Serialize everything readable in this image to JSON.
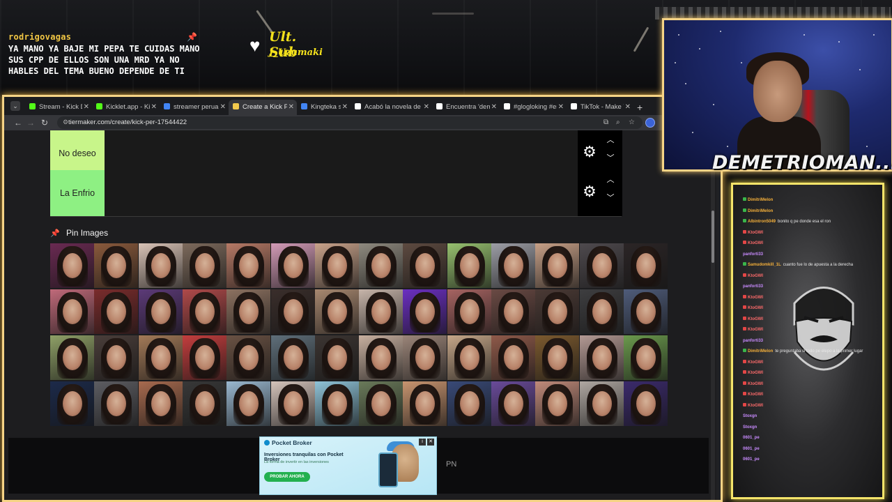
{
  "overlay": {
    "chat_username": "rodrigovagas",
    "chat_message_lines": [
      "YA MANO YA BAJE MI PEPA TE CUIDAS MANO",
      "SUS CPP DE ELLOS SON UNA MRD YA NO",
      "HABLES DEL TEMA BUENO DEPENDE DE TI"
    ],
    "sub_title": "Ult. Sub",
    "sub_name": "J_Uzumaki",
    "streamer_name": "DEMETRIOMAN..."
  },
  "browser": {
    "tabs": [
      {
        "label": "Stream - Kick Dashbo",
        "favicon_color": "#53fc18",
        "active": false
      },
      {
        "label": "Kicklet.app - Kick",
        "favicon_color": "#53fc18",
        "active": false
      },
      {
        "label": "streamer peruano gu",
        "favicon_color": "#4285f4",
        "active": false
      },
      {
        "label": "Create a Kick Perú Ti",
        "favicon_color": "#f2c94c",
        "active": true
      },
      {
        "label": "Kingteka streamer pe",
        "favicon_color": "#4285f4",
        "active": false
      },
      {
        "label": "Acabó la novela de D",
        "favicon_color": "#ffffff",
        "active": false
      },
      {
        "label": "Encuentra 'demetrio",
        "favicon_color": "#ffffff",
        "active": false
      },
      {
        "label": "#glogloking #emeta",
        "favicon_color": "#ffffff",
        "active": false
      },
      {
        "label": "TikTok - Make Your D",
        "favicon_color": "#ffffff",
        "active": false
      }
    ],
    "url": "tiermaker.com/create/kick-per-17544422"
  },
  "tiers": [
    {
      "label": "No deseo",
      "color": "#c8f58a"
    },
    {
      "label": "La Enfrio",
      "color": "#8ef083"
    }
  ],
  "pin_images_label": "Pin Images",
  "ad": {
    "brand": "Pocket Broker",
    "headline": "Inversiones tranquilas con Pocket Broker",
    "sub": "La forma de invertir en las inversiones",
    "cta": "PROBAR AHORA"
  },
  "pn_text": "PN",
  "chat_panel": {
    "lines": [
      {
        "user": "DimitriMelon",
        "text": "",
        "badge": "green"
      },
      {
        "user": "DimitriMelon",
        "text": "",
        "badge": "green"
      },
      {
        "user": "Albintron5049",
        "text": "bonito q pe donde esa el ron",
        "badge": "green"
      },
      {
        "user": "KtoGWI",
        "text": "",
        "badge": "red"
      },
      {
        "user": "KtoGWI",
        "text": "",
        "badge": "red"
      },
      {
        "user": "panforti33",
        "text": "",
        "badge": "none"
      },
      {
        "user": "Samudomkill_1L",
        "text": "cuanto fue lo de apuesta a la derecha",
        "badge": "green"
      },
      {
        "user": "KtoGWI",
        "text": "",
        "badge": "red"
      },
      {
        "user": "panforti33",
        "text": "",
        "badge": "none"
      },
      {
        "user": "KtoGWI",
        "text": "",
        "badge": "red"
      },
      {
        "user": "KtoGWI",
        "text": "",
        "badge": "red"
      },
      {
        "user": "KtoGWI",
        "text": "",
        "badge": "red"
      },
      {
        "user": "KtoGWI",
        "text": "",
        "badge": "red"
      },
      {
        "user": "panforti33",
        "text": "",
        "badge": "none"
      },
      {
        "user": "DimitriMelon",
        "text": "te preguntaba si todo pe elepo a la primer lugar",
        "badge": "green"
      },
      {
        "user": "KtoGWI",
        "text": "",
        "badge": "red"
      },
      {
        "user": "KtoGWI",
        "text": "",
        "badge": "red"
      },
      {
        "user": "KtoGWI",
        "text": "",
        "badge": "red"
      },
      {
        "user": "KtoGWI",
        "text": "",
        "badge": "red"
      },
      {
        "user": "KtoGWI",
        "text": "",
        "badge": "red"
      },
      {
        "user": "Stoxgn",
        "text": "",
        "badge": "none"
      },
      {
        "user": "Stoxgn",
        "text": "",
        "badge": "none"
      },
      {
        "user": "0601_pe",
        "text": "",
        "badge": "none"
      },
      {
        "user": "0601_pe",
        "text": "",
        "badge": "none"
      },
      {
        "user": "0601_pe",
        "text": "",
        "badge": "none"
      }
    ]
  },
  "image_grid": {
    "columns": 14,
    "rows": 4,
    "palette": [
      "#6a2a52",
      "#8a5a3c",
      "#d9c3b6",
      "#7d6a5c",
      "#b77a66",
      "#d39bb7",
      "#c9a38b",
      "#8f8a7f",
      "#5d4a40",
      "#97c16f",
      "#9d9ea6",
      "#c7a087",
      "#4f4a4e",
      "#2b2526",
      "#c06a7a",
      "#7a2c2c",
      "#5c3a78",
      "#b04a4a",
      "#8d7261",
      "#3a2e2b",
      "#a88870",
      "#c7b5aa",
      "#6b2fc2",
      "#a76462",
      "#6a4a44",
      "#4b3a35",
      "#3e3e40",
      "#4f5c7a",
      "#8fa067",
      "#4a3e3a",
      "#a37a58",
      "#c43e3e",
      "#6a5244",
      "#5f6f7a",
      "#3c3532",
      "#c8b0a0",
      "#9b8579",
      "#c6a789",
      "#8f5a4a",
      "#7c5a2f",
      "#b49a94",
      "#6b9a4d",
      "#1c2a4a",
      "#5d5d62",
      "#a86b4f",
      "#383838",
      "#9ab8d0",
      "#d5c4bb",
      "#8fc3d8",
      "#6a7a5a",
      "#c99570",
      "#394a78",
      "#6a4b9a",
      "#c08a7a",
      "#b0a8a2",
      "#3b2a6c"
    ]
  }
}
